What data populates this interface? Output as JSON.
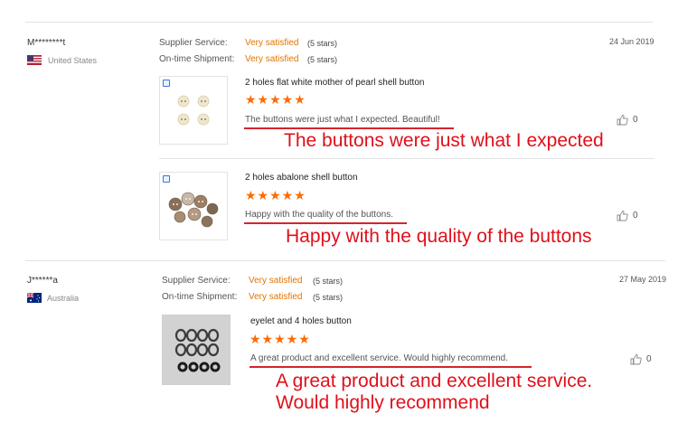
{
  "reviews": [
    {
      "buyer": "M********t",
      "country": "United States",
      "supplier_label": "Supplier Service:",
      "supplier_value": "Very satisfied",
      "supplier_stars": "(5 stars)",
      "shipment_label": "On-time Shipment:",
      "shipment_value": "Very satisfied",
      "shipment_stars": "(5 stars)",
      "date": "24 Jun 2019",
      "items": [
        {
          "product": "2 holes flat white mother of pearl shell button",
          "stars": "★★★★★",
          "text": "The buttons were just what I expected. Beautiful!",
          "likes": "0",
          "annotation": "The buttons were just what I expected"
        },
        {
          "product": "2 holes abalone shell button",
          "stars": "★★★★★",
          "text": "Happy with the quality of the buttons.",
          "likes": "0",
          "annotation": "Happy with the quality of the buttons"
        }
      ]
    },
    {
      "buyer": "J******a",
      "country": "Australia",
      "supplier_label": "Supplier Service:",
      "supplier_value": "Very satisfied",
      "supplier_stars": "(5 stars)",
      "shipment_label": "On-time Shipment:",
      "shipment_value": "Very satisfied",
      "shipment_stars": "(5 stars)",
      "date": "27 May 2019",
      "items": [
        {
          "product": "eyelet and 4 holes button",
          "stars": "★★★★★",
          "text": "A great product and excellent service. Would highly recommend.",
          "likes": "0",
          "annotation_line1": "A great product and excellent service.",
          "annotation_line2": "Would highly recommend"
        }
      ]
    }
  ],
  "icons": {
    "like": "thumbs-up-icon",
    "flag_us": "us-flag-icon",
    "flag_au": "australia-flag-icon"
  },
  "colors": {
    "accent": "#ff6a00",
    "status": "#e27400",
    "annotation": "#e0101b"
  }
}
